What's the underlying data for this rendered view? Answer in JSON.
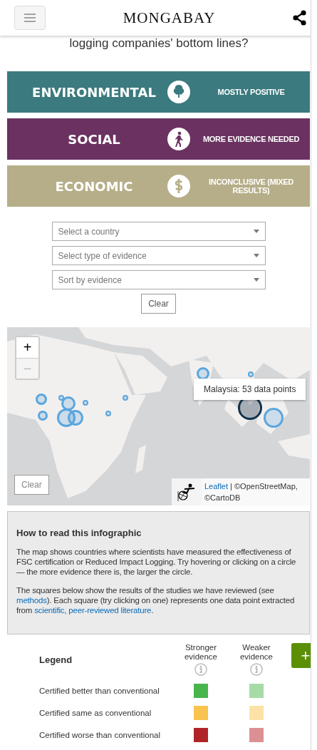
{
  "header": {
    "logo": "MONGABAY"
  },
  "subtitle": "logging companies' bottom lines?",
  "categories": [
    {
      "name": "ENVIRONMENTAL",
      "kind": "tree",
      "color": "#3b7a7e",
      "verdict": "MOSTLY POSITIVE"
    },
    {
      "name": "SOCIAL",
      "kind": "person",
      "color": "#6a3161",
      "verdict": "MORE EVIDENCE NEEDED"
    },
    {
      "name": "ECONOMIC",
      "kind": "dollar",
      "color": "#b6ae89",
      "verdict": "INCONCLUSIVE (MIXED RESULTS)"
    }
  ],
  "filters": [
    {
      "placeholder": "Select a country"
    },
    {
      "placeholder": "Select type of evidence"
    },
    {
      "placeholder": "Sort by evidence"
    }
  ],
  "clear_button": "Clear",
  "map": {
    "zoom_in": "+",
    "zoom_out": "−",
    "tooltip": "Malaysia: 53 data points",
    "clear_button": "Clear",
    "attribution_link": "Leaflet",
    "attribution": " | ©OpenStreetMap, ©CartoDB"
  },
  "info": {
    "title": "How to read this infographic",
    "paragraphs": [
      [
        {
          "text": "The map shows countries where scientists have measured the effectiveness of FSC certification or Reduced Impact Logging. Try hovering or clicking on a circle — the more evidence there is, the larger the circle.",
          "link": false
        }
      ],
      [
        {
          "text": "The squares below show the results of the studies we have reviewed (see ",
          "link": false
        },
        {
          "text": "methods",
          "link": true
        },
        {
          "text": "). Each square (try clicking on one) represents one data point extracted from ",
          "link": false
        },
        {
          "text": "scientific, peer-reviewed literature",
          "link": true
        },
        {
          "text": ".",
          "link": false
        }
      ]
    ]
  },
  "legend": {
    "title": "Legend",
    "columns": [
      "Stronger evidence",
      "Weaker evidence"
    ],
    "add_button": "+",
    "rows": [
      {
        "label": "Certified better than conventional",
        "swatches": [
          {
            "color": "#48b54c"
          },
          {
            "color": "#a6dba8"
          }
        ]
      },
      {
        "label": "Certified same as conventional",
        "swatches": [
          {
            "color": "#f8c34e"
          },
          {
            "color": "#fce2a6"
          }
        ]
      },
      {
        "label": "Certified worse than conventional",
        "swatches": [
          {
            "color": "#b02428"
          },
          {
            "color": "#db9193"
          }
        ]
      }
    ]
  }
}
